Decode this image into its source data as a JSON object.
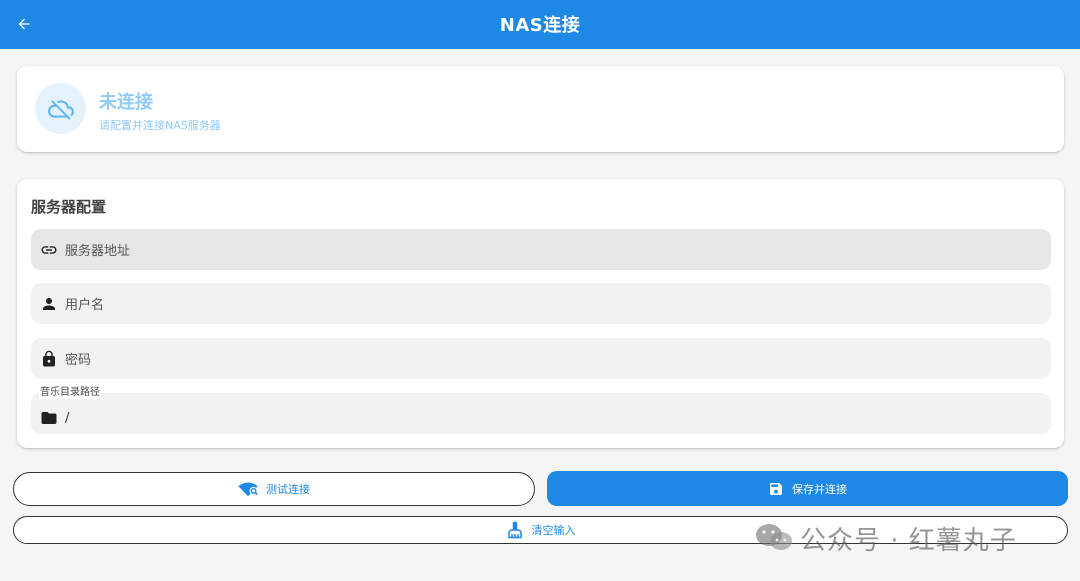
{
  "appbar": {
    "title": "NAS连接"
  },
  "status": {
    "title": "未连接",
    "subtitle": "请配置并连接NAS服务器"
  },
  "config": {
    "section_title": "服务器配置",
    "server_address": {
      "placeholder": "服务器地址",
      "icon": "link-icon"
    },
    "username": {
      "placeholder": "用户名",
      "icon": "person-icon"
    },
    "password": {
      "placeholder": "密码",
      "icon": "lock-icon"
    },
    "music_path": {
      "label": "音乐目录路径",
      "value": "/",
      "icon": "folder-icon"
    }
  },
  "actions": {
    "test_label": "测试连接",
    "save_label": "保存并连接",
    "clear_label": "清空输入"
  },
  "watermark": {
    "text": "公众号 · 红薯丸子"
  },
  "colors": {
    "primary": "#1e88e5",
    "status_light": "#90caf9",
    "status_bg": "#e3f2fd"
  }
}
